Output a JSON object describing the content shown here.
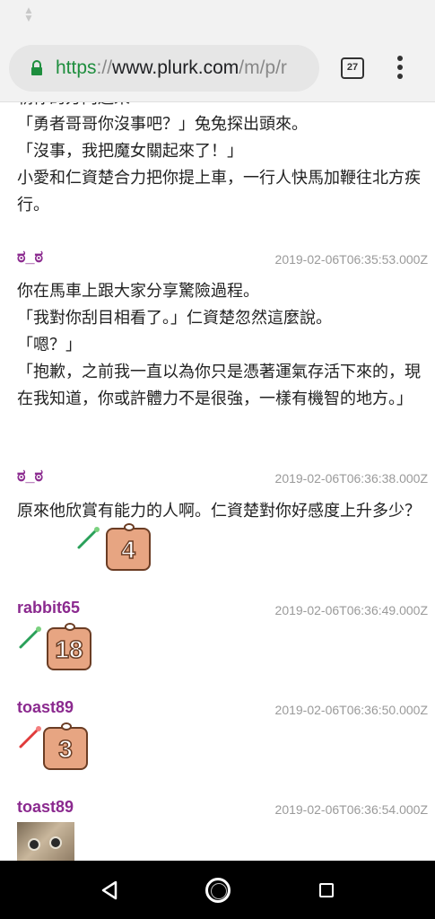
{
  "browser": {
    "url_scheme": "https",
    "url_separator": "://",
    "url_host": "www.plurk.com",
    "url_path": "/m/p/r",
    "tab_count": "27"
  },
  "thread": {
    "intro": {
      "cut_line": "朝你的方向過來",
      "lines": [
        "「勇者哥哥你沒事吧？」兔兔探出頭來。",
        "「沒事，我把魔女關起來了！」",
        "小愛和仁資楚合力把你提上車，一行人快馬加鞭往北方疾行。"
      ]
    },
    "responses": [
      {
        "author": "ಠ_ಠ",
        "timestamp": "2019-02-06T06:35:53.000Z",
        "lines": [
          "你在馬車上跟大家分享驚險過程。",
          "「我對你刮目相看了。」仁資楚忽然這麼說。",
          "「嗯？」",
          "「抱歉，之前我一直以為你只是憑著運氣存活下來的，現在我知道，你或許體力不是很強，一樣有機智的地方。」"
        ]
      },
      {
        "author": "ಠ_ಠ",
        "timestamp": "2019-02-06T06:36:38.000Z",
        "lines": [
          "原來他欣賞有能力的人啊。仁資楚對你好感度上升多少？"
        ],
        "dice_value": "4"
      },
      {
        "author": "rabbit65",
        "timestamp": "2019-02-06T06:36:49.000Z",
        "dice_value": "18"
      },
      {
        "author": "toast89",
        "timestamp": "2019-02-06T06:36:50.000Z",
        "dice_value": "3"
      },
      {
        "author": "toast89",
        "timestamp": "2019-02-06T06:36:54.000Z"
      }
    ]
  },
  "colors": {
    "author": "#8b2a8f",
    "timestamp": "#9a9a9a",
    "url_scheme": "#1e8e3e",
    "dice_fill": "#e7a582"
  },
  "icons": [
    "lock-icon",
    "menu-dots-icon",
    "wand-icon",
    "dice-icon",
    "back-icon",
    "home-icon",
    "recents-icon"
  ]
}
